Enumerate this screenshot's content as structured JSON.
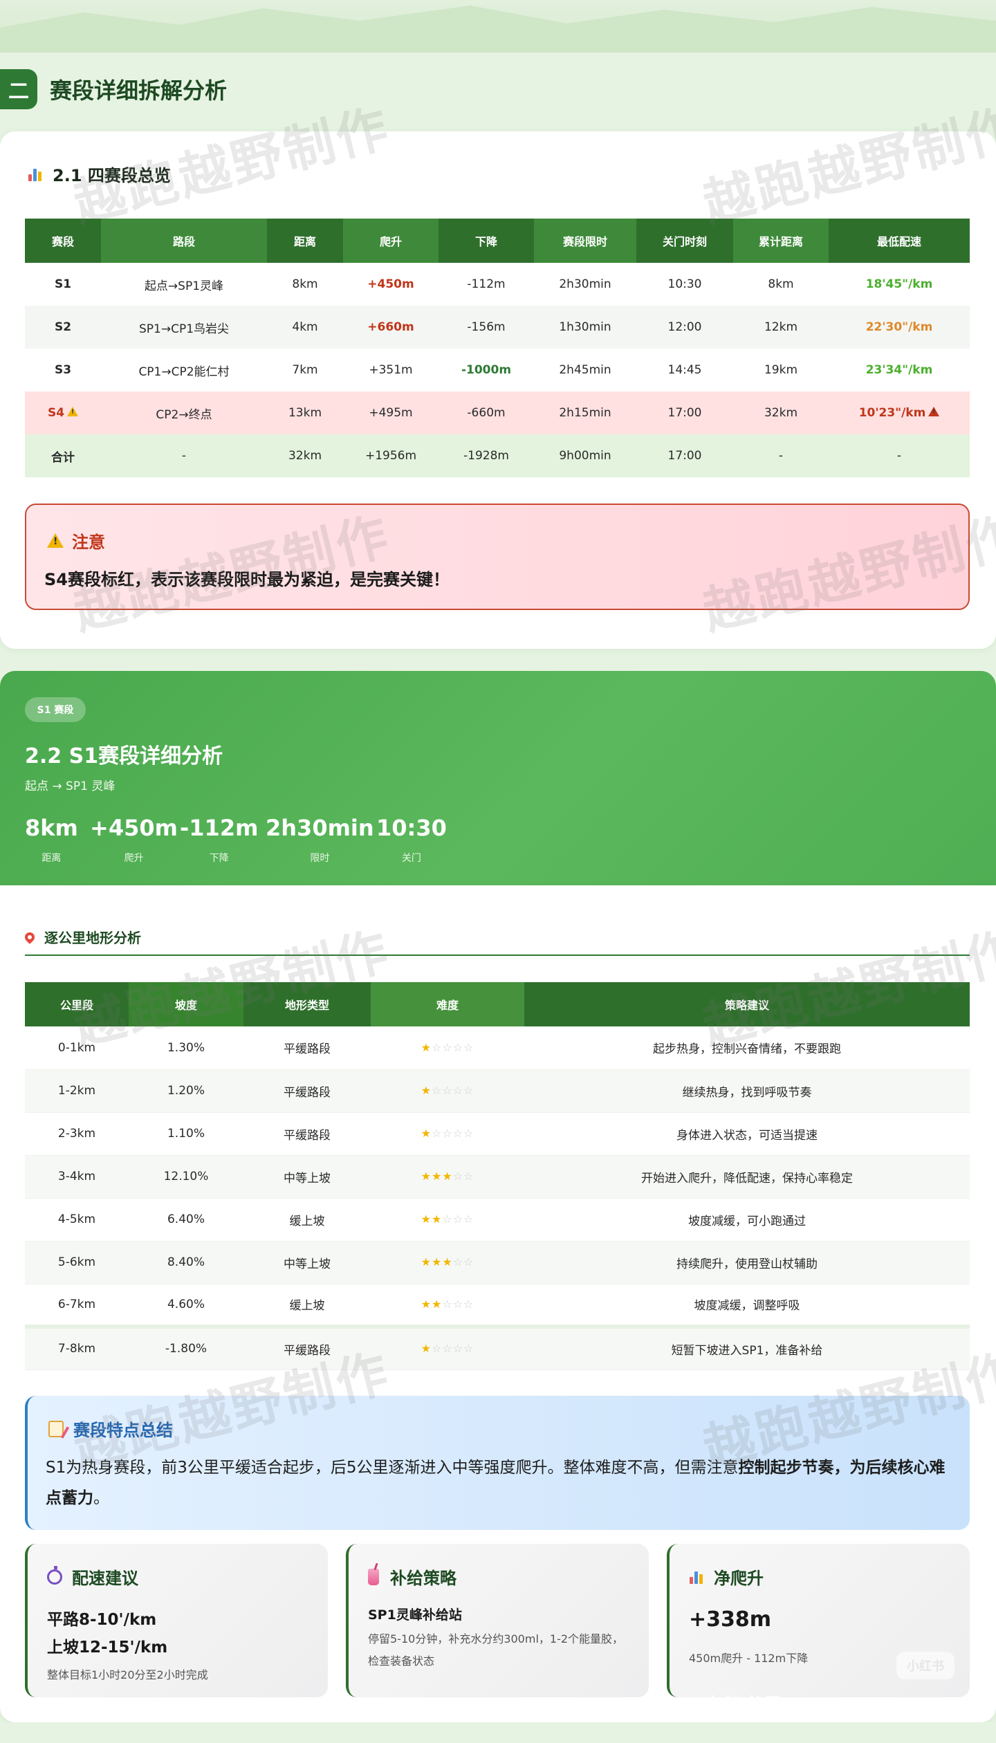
{
  "section": {
    "number": "二",
    "title": "赛段详细拆解分析"
  },
  "overview": {
    "title": "2.1 四赛段总览",
    "headers": [
      "赛段",
      "路段",
      "距离",
      "爬升",
      "下降",
      "赛段限时",
      "关门时刻",
      "累计距离",
      "最低配速"
    ],
    "rows": [
      {
        "seg": "S1",
        "route": "起点→SP1灵峰",
        "dist": "8km",
        "up": "+450m",
        "down": "-112m",
        "limit": "2h30min",
        "close": "10:30",
        "cum": "8km",
        "pace": "18'45\"/km"
      },
      {
        "seg": "S2",
        "route": "SP1→CP1鸟岩尖",
        "dist": "4km",
        "up": "+660m",
        "down": "-156m",
        "limit": "1h30min",
        "close": "12:00",
        "cum": "12km",
        "pace": "22'30\"/km"
      },
      {
        "seg": "S3",
        "route": "CP1→CP2能仁村",
        "dist": "7km",
        "up": "+351m",
        "down": "-1000m",
        "limit": "2h45min",
        "close": "14:45",
        "cum": "19km",
        "pace": "23'34\"/km"
      },
      {
        "seg": "S4",
        "route": "CP2→终点",
        "dist": "13km",
        "up": "+495m",
        "down": "-660m",
        "limit": "2h15min",
        "close": "17:00",
        "cum": "32km",
        "pace": "10'23\"/km"
      },
      {
        "seg": "合计",
        "route": "-",
        "dist": "32km",
        "up": "+1956m",
        "down": "-1928m",
        "limit": "9h00min",
        "close": "17:00",
        "cum": "-",
        "pace": "-"
      }
    ]
  },
  "notice": {
    "title": "注意",
    "text": "S4赛段标红，表示该赛段限时最为紧迫，是完赛关键！"
  },
  "s1": {
    "badge": "S1 赛段",
    "title": "2.2 S1赛段详细分析",
    "route": "起点 → SP1 灵峰",
    "stats": [
      {
        "value": "8km",
        "label": "距离"
      },
      {
        "value": "+450m",
        "label": "爬升"
      },
      {
        "value": "-112m",
        "label": "下降"
      },
      {
        "value": "2h30min",
        "label": "限时"
      },
      {
        "value": "10:30",
        "label": "关门"
      }
    ]
  },
  "terrain": {
    "title": "逐公里地形分析",
    "headers": [
      "公里段",
      "坡度",
      "地形类型",
      "难度",
      "策略建议"
    ],
    "rows": [
      {
        "km": "0-1km",
        "grade": "1.30%",
        "type": "平缓路段",
        "stars": 1,
        "tip": "起步热身，控制兴奋情绪，不要跟跑"
      },
      {
        "km": "1-2km",
        "grade": "1.20%",
        "type": "平缓路段",
        "stars": 1,
        "tip": "继续热身，找到呼吸节奏"
      },
      {
        "km": "2-3km",
        "grade": "1.10%",
        "type": "平缓路段",
        "stars": 1,
        "tip": "身体进入状态，可适当提速"
      },
      {
        "km": "3-4km",
        "grade": "12.10%",
        "type": "中等上坡",
        "stars": 3,
        "tip": "开始进入爬升，降低配速，保持心率稳定"
      },
      {
        "km": "4-5km",
        "grade": "6.40%",
        "type": "缓上坡",
        "stars": 2,
        "tip": "坡度减缓，可小跑通过"
      },
      {
        "km": "5-6km",
        "grade": "8.40%",
        "type": "中等上坡",
        "stars": 3,
        "tip": "持续爬升，使用登山杖辅助"
      },
      {
        "km": "6-7km",
        "grade": "4.60%",
        "type": "缓上坡",
        "stars": 2,
        "tip": "坡度减缓，调整呼吸"
      },
      {
        "km": "7-8km",
        "grade": "-1.80%",
        "type": "平缓路段",
        "stars": 1,
        "tip": "短暂下坡进入SP1，准备补给"
      }
    ]
  },
  "summary": {
    "title": "赛段特点总结",
    "text_a": "S1为热身赛段，前3公里平缓适合起步，后5公里逐渐进入中等强度爬升。整体难度不高，但需注意",
    "text_b": "控制起步节奏，为后续核心难点蓄力",
    "text_c": "。"
  },
  "cards": {
    "pace": {
      "title": "配速建议",
      "line1": "平路8-10'/km",
      "line2": "上坡12-15'/km",
      "note": "整体目标1小时20分至2小时完成"
    },
    "supply": {
      "title": "补给策略",
      "line1": "SP1灵峰补给站",
      "note": "停留5-10分钟，补充水分约300ml，1-2个能量胶，检查装备状态"
    },
    "climb": {
      "title": "净爬升",
      "value": "+338m",
      "note": "450m爬升 - 112m下降"
    }
  },
  "watermark": "越跑越野制作",
  "credit": "小红书号：xingzaipeiwan",
  "logo": "小红书"
}
